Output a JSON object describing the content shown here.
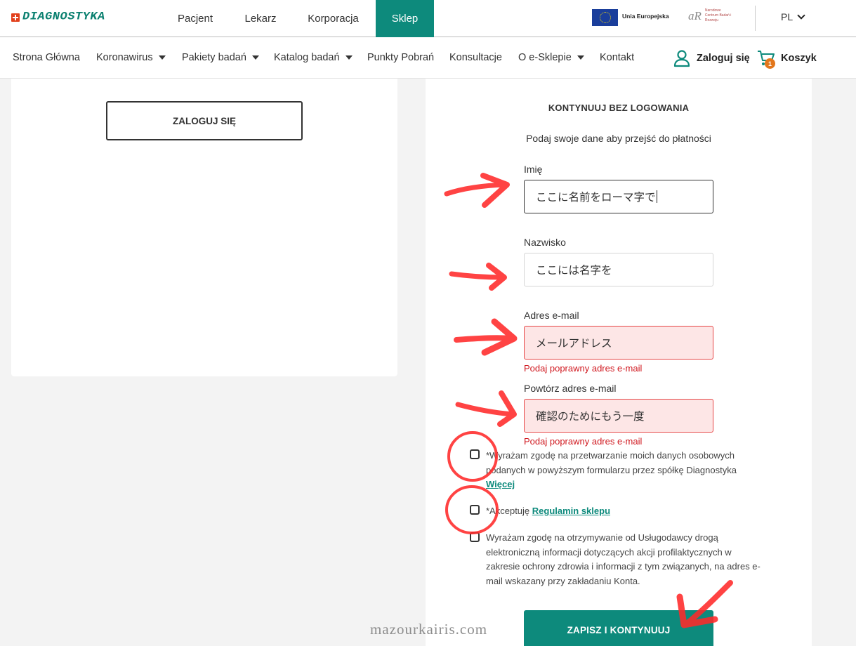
{
  "topbar": {
    "logo": "DIAGNOSTYKA",
    "tabs": [
      "Pacjent",
      "Lekarz",
      "Korporacja",
      "Sklep"
    ],
    "eu_label": "Unia Europejska",
    "abr_text": "Narodowe Centrum Badań i Rozwoju",
    "language": "PL"
  },
  "nav": {
    "items": [
      "Strona Główna",
      "Koronawirus",
      "Pakiety badań",
      "Katalog badań",
      "Punkty Pobrań",
      "Konsultacje",
      "O e-Sklepie",
      "Kontakt"
    ],
    "login": "Zaloguj się",
    "cart": "Koszyk",
    "cart_count": "1"
  },
  "left_panel": {
    "login_button": "ZALOGUJ SIĘ"
  },
  "form": {
    "title": "KONTYNUUJ BEZ LOGOWANIA",
    "subtitle": "Podaj swoje dane aby przejść do płatności",
    "first_name": {
      "label": "Imię",
      "value": "ここに名前をローマ字で"
    },
    "last_name": {
      "label": "Nazwisko",
      "value": "ここには名字を"
    },
    "email": {
      "label": "Adres e-mail",
      "value": "メールアドレス",
      "error": "Podaj poprawny adres e-mail"
    },
    "email_repeat": {
      "label": "Powtórz adres e-mail",
      "value": "確認のためにもう一度",
      "error": "Podaj poprawny adres e-mail"
    },
    "consent1": {
      "text": "*Wyrażam zgodę na przetwarzanie moich danych osobowych podanych w powyższym formularzu przez spółkę Diagnostyka",
      "link": "Więcej"
    },
    "consent2": {
      "text": "*Akceptuję ",
      "link": "Regulamin sklepu"
    },
    "consent3": {
      "text": "Wyrażam zgodę na otrzymywanie od Usługodawcy drogą elektroniczną informacji dotyczących akcji profilaktycznych w zakresie ochrony zdrowia i informacji z tym związanych, na adres e-mail wskazany przy zakładaniu Konta."
    },
    "submit": "ZAPISZ I KONTYNUUJ"
  },
  "watermark": "mazourkairis.com",
  "colors": {
    "brand": "#0d8a7c",
    "error": "#d0181f",
    "annotation": "#ff2a2a",
    "badge": "#e2761c"
  }
}
